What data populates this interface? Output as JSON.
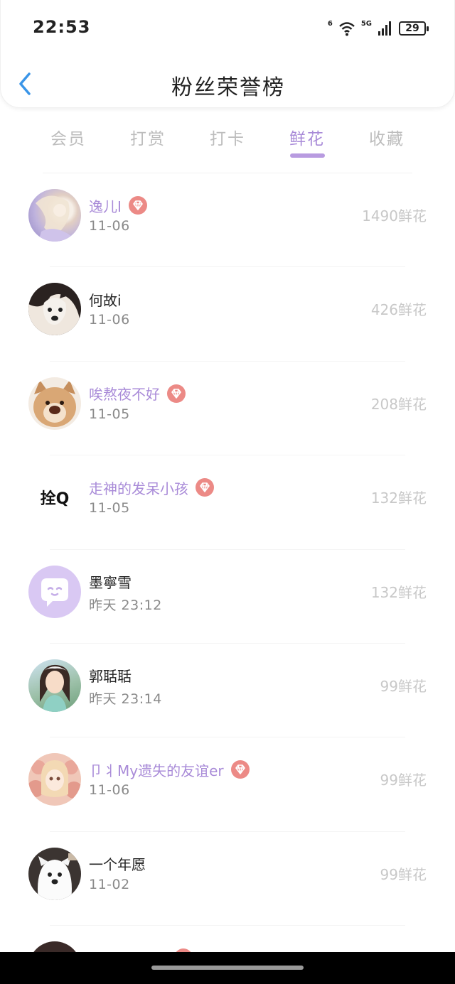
{
  "status_bar": {
    "time": "22:53",
    "network_1": "6",
    "network_2": "5G",
    "battery": "29"
  },
  "header": {
    "title": "粉丝荣誉榜"
  },
  "tabs": [
    {
      "label": "会员",
      "active": false
    },
    {
      "label": "打赏",
      "active": false
    },
    {
      "label": "打卡",
      "active": false
    },
    {
      "label": "鲜花",
      "active": true
    },
    {
      "label": "收藏",
      "active": false
    }
  ],
  "fans": [
    {
      "name": "逸儿I",
      "date": "11-06",
      "amount": "1490鲜花",
      "vip": true
    },
    {
      "name": "何故i",
      "date": "11-06",
      "amount": "426鲜花",
      "vip": false
    },
    {
      "name": "唉熬夜不好",
      "date": "11-05",
      "amount": "208鲜花",
      "vip": true
    },
    {
      "name": "走神的发呆小孩",
      "date": "11-05",
      "amount": "132鲜花",
      "vip": true,
      "avatar_text": "拴Q"
    },
    {
      "name": "墨寧雪",
      "date": "昨天 23:12",
      "amount": "132鲜花",
      "vip": false
    },
    {
      "name": "郭聒聒",
      "date": "昨天 23:14",
      "amount": "99鲜花",
      "vip": false
    },
    {
      "name": "卩丬My遗失的友谊er",
      "date": "11-06",
      "amount": "99鲜花",
      "vip": true
    },
    {
      "name": "一个年愿",
      "date": "11-02",
      "amount": "99鲜花",
      "vip": false
    }
  ],
  "colors": {
    "accent": "#a98bd8",
    "gem": "#ec8a86",
    "amount": "#c8c8c8"
  }
}
